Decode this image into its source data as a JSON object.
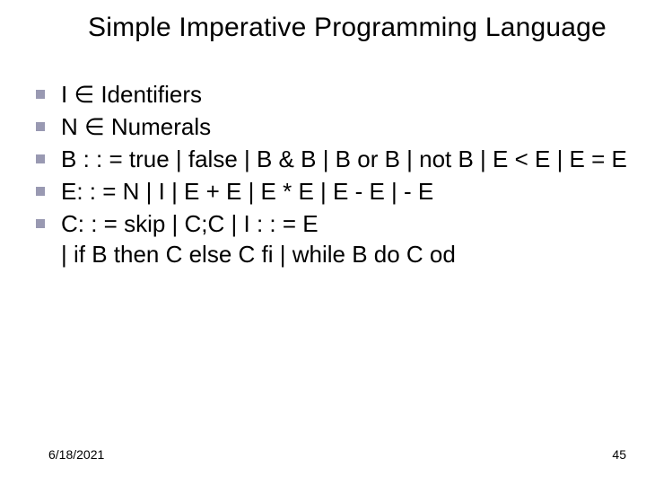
{
  "title": "Simple Imperative Programming Language",
  "bullets": [
    "I ∈ Identifiers",
    "N ∈ Numerals",
    "B : : = true | false | B & B | B or B | not B  | E < E | E = E",
    "E: : = N | I | E + E | E * E | E - E | - E",
    "C: : = skip | C;C | I : : = E\n| if B then C else C fi | while B do C od"
  ],
  "footer": {
    "date": "6/18/2021",
    "page": "45"
  }
}
